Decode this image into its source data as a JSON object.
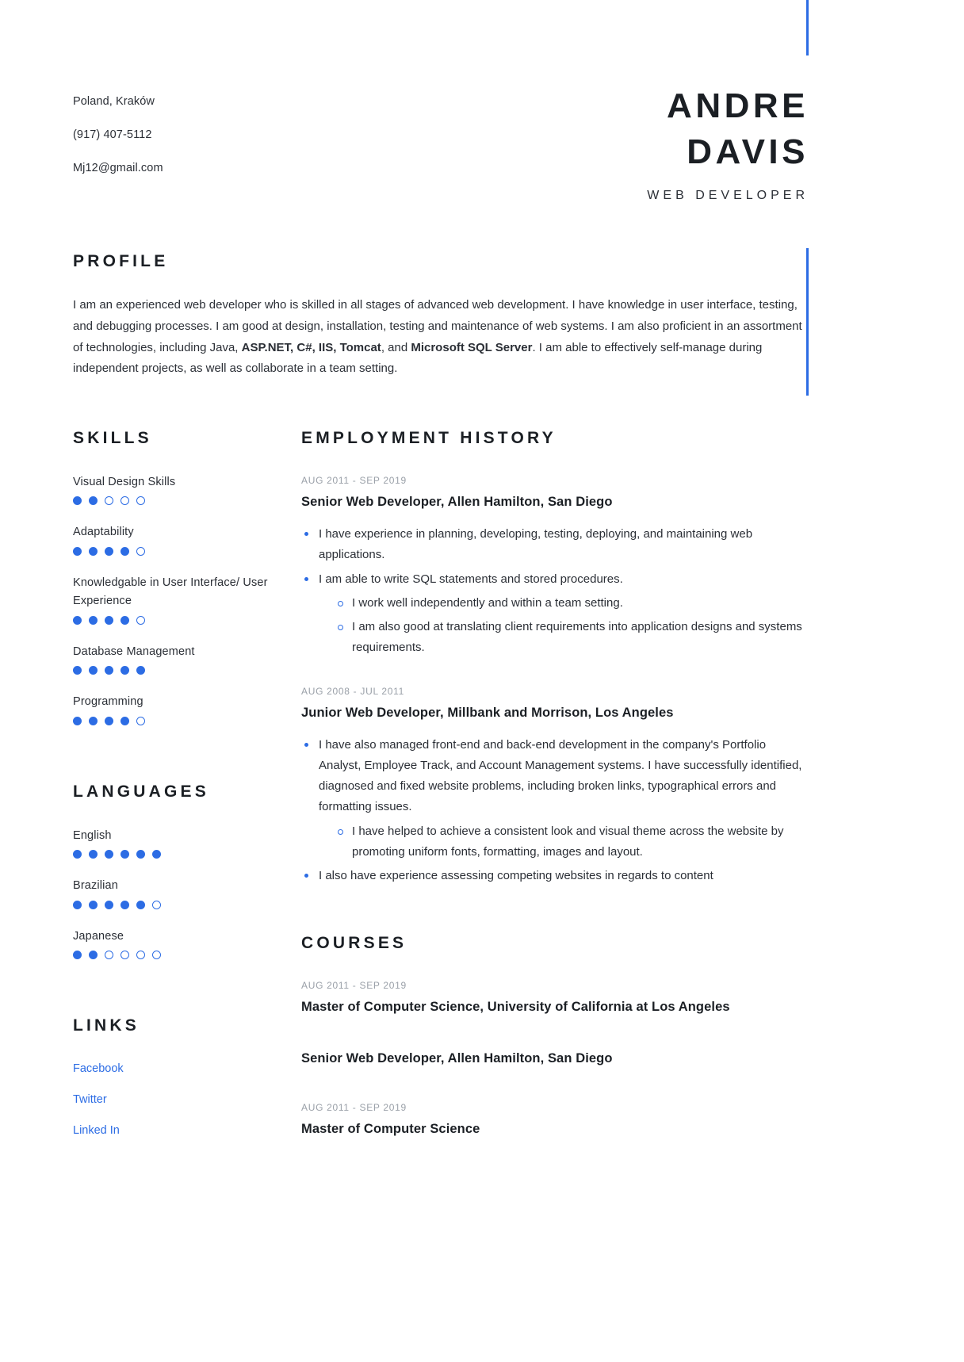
{
  "accent_color": "#2c6ce4",
  "header": {
    "contact": [
      "Poland, Kraków",
      "(917) 407-5112",
      "Mj12@gmail.com"
    ],
    "first_name": "ANDRE",
    "last_name": "DAVIS",
    "job_title": "WEB DEVELOPER"
  },
  "profile": {
    "heading": "PROFILE",
    "text_part1": "I am an experienced web developer who is skilled in all stages of advanced web development. I have knowledge in user interface, testing, and debugging processes. I am good at design, installation, testing and maintenance of web systems. I am also proficient in an assortment of technologies, including Java, ",
    "bold1": "ASP.NET, C#, IIS, Tomcat",
    "text_part2": ", and ",
    "bold2": "Microsoft SQL Server",
    "text_part3": ". I am able to effectively self-manage during independent projects, as well as collaborate in a team setting."
  },
  "skills": {
    "heading": "SKILLS",
    "max": 5,
    "items": [
      {
        "label": "Visual Design Skills",
        "rating": 2
      },
      {
        "label": "Adaptability",
        "rating": 4
      },
      {
        "label": "Knowledgable in User Interface/ User Experience",
        "rating": 4
      },
      {
        "label": "Database Management",
        "rating": 5
      },
      {
        "label": "Programming",
        "rating": 4
      }
    ]
  },
  "languages": {
    "heading": "LANGUAGES",
    "max": 6,
    "items": [
      {
        "label": "English",
        "rating": 6
      },
      {
        "label": "Brazilian",
        "rating": 5
      },
      {
        "label": "Japanese",
        "rating": 2
      }
    ]
  },
  "links": {
    "heading": "LINKS",
    "items": [
      {
        "label": "Facebook"
      },
      {
        "label": "Twitter"
      },
      {
        "label": "Linked In"
      }
    ]
  },
  "employment": {
    "heading": "EMPLOYMENT HISTORY",
    "entries": [
      {
        "date": "AUG 2011 - SEP 2019",
        "title": "Senior Web Developer, Allen Hamilton,  San Diego",
        "bullets": [
          {
            "text": "I have experience in planning, developing, testing, deploying, and maintaining web applications.",
            "sub": []
          },
          {
            "text": "I am able to write SQL statements and stored procedures.",
            "sub": [
              "I work well independently and within a team setting.",
              "I am also good at translating client requirements into application designs and systems requirements."
            ]
          }
        ]
      },
      {
        "date": "AUG 2008 - JUL 2011",
        "title": "Junior Web Developer, Millbank and Morrison, Los Angeles",
        "bullets": [
          {
            "text": "I have also managed front-end and back-end development in the company's Portfolio Analyst, Employee Track, and Account Management systems. I have successfully identified, diagnosed and fixed website problems, including broken links, typographical errors and formatting issues.",
            "sub": [
              "I have helped to achieve a consistent look and visual theme across the website by promoting uniform fonts, formatting, images and layout."
            ]
          },
          {
            "text": "I also have experience assessing competing websites in regards to content",
            "sub": []
          }
        ]
      }
    ]
  },
  "courses": {
    "heading": "COURSES",
    "entries": [
      {
        "date": "AUG 2011 - SEP 2019",
        "title": "Master of Computer Science, University of California at Los Angeles"
      },
      {
        "date": "",
        "title": "Senior Web Developer, Allen Hamilton,  San Diego"
      },
      {
        "date": "AUG 2011 - SEP 2019",
        "title": "Master of Computer Science"
      }
    ]
  }
}
